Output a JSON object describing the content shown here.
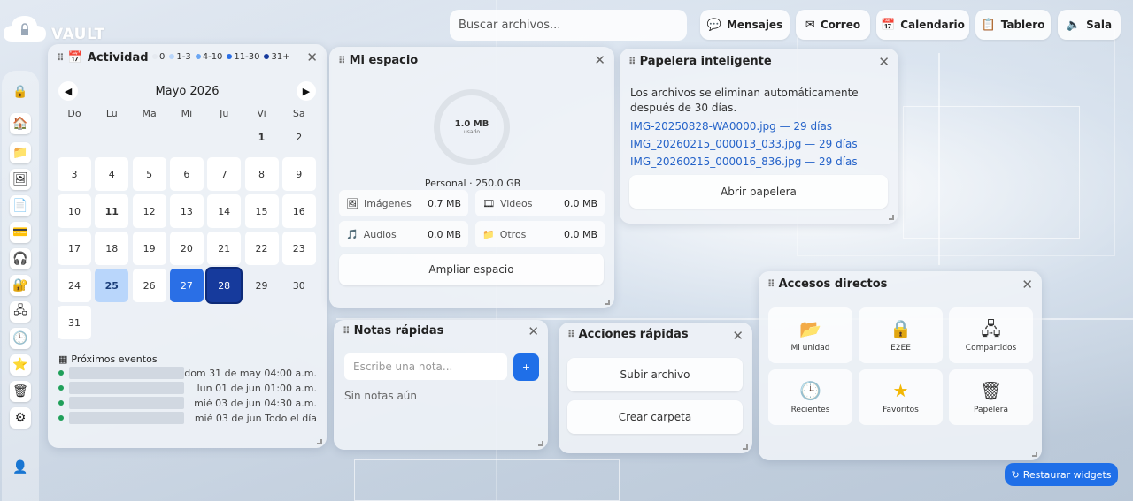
{
  "app": {
    "name": "VAULT"
  },
  "search": {
    "placeholder": "Buscar archivos..."
  },
  "topnav": [
    {
      "label": "Mensajes",
      "icon": "chat-icon"
    },
    {
      "label": "Correo",
      "icon": "mail-icon"
    },
    {
      "label": "Calendario",
      "icon": "calendar-icon"
    },
    {
      "label": "Tablero",
      "icon": "clipboard-icon"
    },
    {
      "label": "Sala",
      "icon": "speaker-icon"
    }
  ],
  "sidebar": {
    "items": [
      {
        "icon": "lock-icon"
      },
      {
        "icon": "home-icon"
      },
      {
        "icon": "folder-icon"
      },
      {
        "icon": "image-icon"
      },
      {
        "icon": "document-icon"
      },
      {
        "icon": "card-icon"
      },
      {
        "icon": "headphones-icon"
      },
      {
        "icon": "padlock-icon"
      },
      {
        "icon": "shared-icon"
      },
      {
        "icon": "clock-icon"
      },
      {
        "icon": "star-icon"
      },
      {
        "icon": "trash-icon"
      },
      {
        "icon": "settings-icon"
      }
    ],
    "footer_icon": "user-icon"
  },
  "activity": {
    "title": "Actividad",
    "legend": [
      {
        "label": "0",
        "color": "#e6eaf0"
      },
      {
        "label": "1-3",
        "color": "#b9d6fb"
      },
      {
        "label": "4-10",
        "color": "#6aa6f3"
      },
      {
        "label": "11-30",
        "color": "#2a6fe6"
      },
      {
        "label": "31+",
        "color": "#163a9c"
      }
    ],
    "month": "Mayo 2026",
    "weekdays": [
      "Do",
      "Lu",
      "Ma",
      "Mi",
      "Ju",
      "Vi",
      "Sa"
    ],
    "days": [
      {
        "d": "1",
        "style": "plain",
        "bold": true
      },
      {
        "d": "2",
        "style": "plain"
      },
      {
        "d": "3",
        "style": "box"
      },
      {
        "d": "4",
        "style": "box"
      },
      {
        "d": "5",
        "style": "box"
      },
      {
        "d": "6",
        "style": "box"
      },
      {
        "d": "7",
        "style": "box"
      },
      {
        "d": "8",
        "style": "box"
      },
      {
        "d": "9",
        "style": "box"
      },
      {
        "d": "10",
        "style": "box"
      },
      {
        "d": "11",
        "style": "box",
        "bold": true
      },
      {
        "d": "12",
        "style": "box"
      },
      {
        "d": "13",
        "style": "box"
      },
      {
        "d": "14",
        "style": "box"
      },
      {
        "d": "15",
        "style": "box"
      },
      {
        "d": "16",
        "style": "box"
      },
      {
        "d": "17",
        "style": "box"
      },
      {
        "d": "18",
        "style": "box"
      },
      {
        "d": "19",
        "style": "box"
      },
      {
        "d": "20",
        "style": "box"
      },
      {
        "d": "21",
        "style": "box"
      },
      {
        "d": "22",
        "style": "box"
      },
      {
        "d": "23",
        "style": "box"
      },
      {
        "d": "24",
        "style": "box"
      },
      {
        "d": "25",
        "style": "light",
        "bold": true
      },
      {
        "d": "26",
        "style": "box"
      },
      {
        "d": "27",
        "style": "mid"
      },
      {
        "d": "28",
        "style": "dark"
      },
      {
        "d": "29",
        "style": "plain"
      },
      {
        "d": "30",
        "style": "plain"
      },
      {
        "d": "31",
        "style": "box"
      }
    ],
    "events_title": "Próximos eventos",
    "events": [
      {
        "when": "dom 31 de may 04:00 a.m."
      },
      {
        "when": "lun 01 de jun 01:00 a.m."
      },
      {
        "when": "mié 03 de jun 04:30 a.m."
      },
      {
        "when": "mié 03 de jun Todo el día"
      }
    ]
  },
  "storage": {
    "title": "Mi espacio",
    "used": "1.0 MB",
    "used_label": "usado",
    "plan": "Personal · 250.0 GB",
    "categories": [
      {
        "name": "Imágenes",
        "value": "0.7 MB",
        "icon": "image-icon"
      },
      {
        "name": "Videos",
        "value": "0.0 MB",
        "icon": "film-icon"
      },
      {
        "name": "Audios",
        "value": "0.0 MB",
        "icon": "music-icon"
      },
      {
        "name": "Otros",
        "value": "0.0 MB",
        "icon": "folder-icon"
      }
    ],
    "button": "Ampliar espacio"
  },
  "trash": {
    "title": "Papelera inteligente",
    "description": "Los archivos se eliminan automáticamente después de 30 días.",
    "files": [
      "IMG-20250828-WA0000.jpg — 29 días",
      "IMG_20260215_000013_033.jpg — 29 días",
      "IMG_20260215_000016_836.jpg — 29 días"
    ],
    "button": "Abrir papelera"
  },
  "notes": {
    "title": "Notas rápidas",
    "placeholder": "Escribe una nota...",
    "add": "+",
    "empty": "Sin notas aún"
  },
  "actions": {
    "title": "Acciones rápidas",
    "upload": "Subir archivo",
    "create": "Crear carpeta"
  },
  "shortcuts": {
    "title": "Accesos directos",
    "items": [
      {
        "label": "Mi unidad",
        "icon": "folder-icon"
      },
      {
        "label": "E2EE",
        "icon": "padlock-icon"
      },
      {
        "label": "Compartidos",
        "icon": "shared-icon"
      },
      {
        "label": "Recientes",
        "icon": "clock-icon"
      },
      {
        "label": "Favoritos",
        "icon": "star-icon"
      },
      {
        "label": "Papelera",
        "icon": "trash-icon"
      }
    ]
  },
  "restore": {
    "label": "Restaurar widgets"
  }
}
